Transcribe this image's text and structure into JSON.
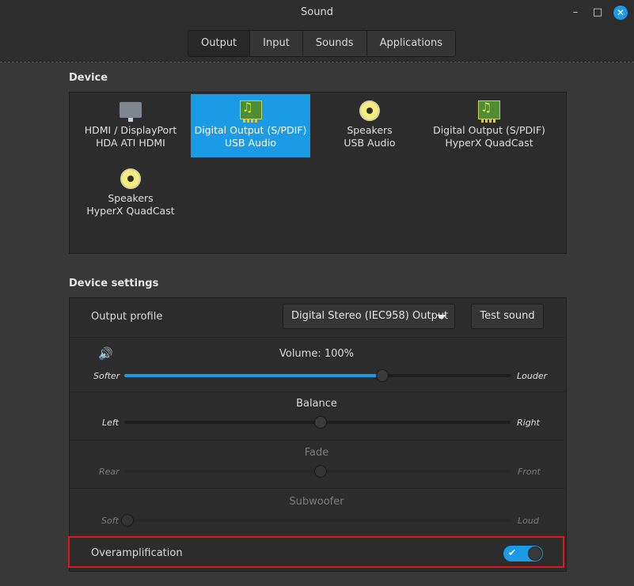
{
  "window": {
    "title": "Sound",
    "minimize_glyph": "–",
    "maximize_glyph": "□",
    "close_glyph": "✕"
  },
  "tabs": [
    {
      "label": "Output",
      "active": true
    },
    {
      "label": "Input",
      "active": false
    },
    {
      "label": "Sounds",
      "active": false
    },
    {
      "label": "Applications",
      "active": false
    }
  ],
  "device_section": {
    "label": "Device",
    "devices": [
      {
        "line1": "HDMI / DisplayPort",
        "line2": "HDA ATI HDMI",
        "icon": "monitor-icon",
        "selected": false
      },
      {
        "line1": "Digital Output (S/PDIF)",
        "line2": "USB Audio",
        "icon": "sound-card-icon",
        "selected": true
      },
      {
        "line1": "Speakers",
        "line2": "USB Audio",
        "icon": "speaker-icon",
        "selected": false
      },
      {
        "line1": "Digital Output (S/PDIF)",
        "line2": "HyperX QuadCast",
        "icon": "sound-card-icon",
        "selected": false
      },
      {
        "line1": "Speakers",
        "line2": "HyperX QuadCast",
        "icon": "speaker-icon",
        "selected": false
      }
    ]
  },
  "settings_section": {
    "label": "Device settings",
    "output_profile": {
      "label": "Output profile",
      "value": "Digital Stereo (IEC958) Output"
    },
    "test_sound_label": "Test sound",
    "volume": {
      "icon": "speaker-volume-icon",
      "icon_glyph": "🔊",
      "label": "Volume: 100%",
      "min_label": "Softer",
      "max_label": "Louder",
      "level": 0.66
    },
    "balance": {
      "label": "Balance",
      "min_label": "Left",
      "max_label": "Right",
      "level": 0.5
    },
    "fade": {
      "label": "Fade",
      "min_label": "Rear",
      "max_label": "Front",
      "level": 0.5,
      "disabled": true
    },
    "subwoofer": {
      "label": "Subwoofer",
      "min_label": "Soft",
      "max_label": "Loud",
      "level": 0.0,
      "disabled": true
    },
    "overamplification": {
      "label": "Overamplification",
      "enabled": true,
      "check_glyph": "✔"
    }
  },
  "colors": {
    "accent": "#1b9ae6",
    "highlight_border": "#e3161b"
  }
}
